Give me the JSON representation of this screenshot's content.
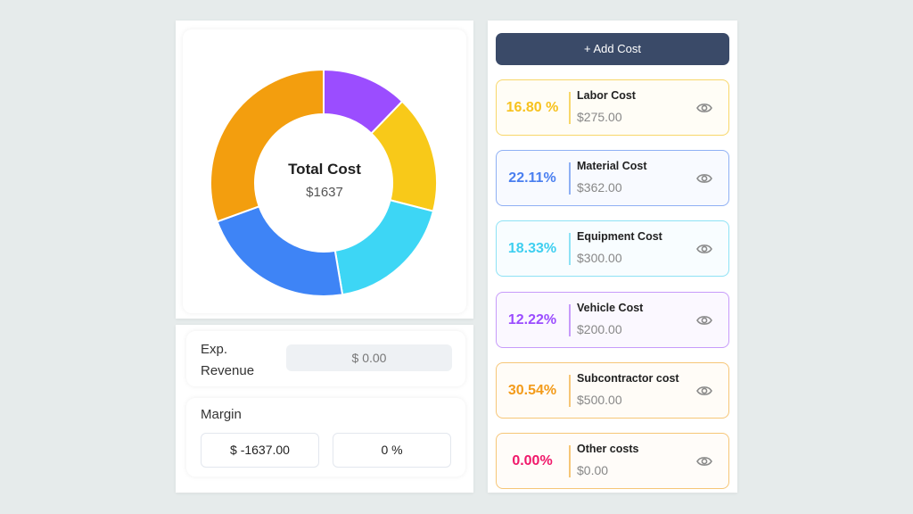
{
  "chart_data": {
    "type": "pie",
    "variant": "donut",
    "title": "Total Cost",
    "center_value": "$1637",
    "start": "top",
    "direction": "clockwise",
    "slices": [
      {
        "label": "Vehicle Cost",
        "value": 200,
        "percent": 12.22,
        "color": "#9b4dff"
      },
      {
        "label": "Labor Cost",
        "value": 275,
        "percent": 16.8,
        "color": "#f8c919"
      },
      {
        "label": "Equipment Cost",
        "value": 300,
        "percent": 18.33,
        "color": "#3dd6f5"
      },
      {
        "label": "Material Cost",
        "value": 362,
        "percent": 22.11,
        "color": "#3e84f6"
      },
      {
        "label": "Subcontractor cost",
        "value": 500,
        "percent": 30.54,
        "color": "#f39e0e"
      },
      {
        "label": "Other costs",
        "value": 0,
        "percent": 0.0,
        "color": "#ff1f70"
      }
    ]
  },
  "summary": {
    "revenue_label": "Exp. Revenue",
    "revenue_value": "$ 0.00",
    "margin_label": "Margin",
    "margin_amount": "$ -1637.00",
    "margin_percent": "0 %"
  },
  "actions": {
    "add_cost_label": "+ Add Cost"
  },
  "costs": [
    {
      "percent": "16.80 %",
      "name": "Labor Cost",
      "amount": "$275.00",
      "color": "#f7c21e",
      "border": "#f8d76a",
      "bg": "#fffdf6",
      "icon": "eye-icon"
    },
    {
      "percent": "22.11%",
      "name": "Material Cost",
      "amount": "$362.00",
      "color": "#4a7ff0",
      "border": "#8fb0f4",
      "bg": "#f8faff",
      "icon": "eye-icon"
    },
    {
      "percent": "18.33%",
      "name": "Equipment Cost",
      "amount": "$300.00",
      "color": "#3fcff0",
      "border": "#8ee2f5",
      "bg": "#f8fdff",
      "icon": "eye-icon"
    },
    {
      "percent": "12.22%",
      "name": "Vehicle Cost",
      "amount": "$200.00",
      "color": "#9b4dff",
      "border": "#c79bfa",
      "bg": "#fbf8ff",
      "icon": "eye-icon"
    },
    {
      "percent": "30.54%",
      "name": "Subcontractor cost",
      "amount": "$500.00",
      "color": "#f39b1a",
      "border": "#f6c677",
      "bg": "#fffcf7",
      "icon": "eye-icon"
    },
    {
      "percent": "0.00%",
      "name": "Other costs",
      "amount": "$0.00",
      "color": "#f0186a",
      "border": "#f6c677",
      "bg": "#fffcf9",
      "icon": "eye-icon"
    }
  ]
}
